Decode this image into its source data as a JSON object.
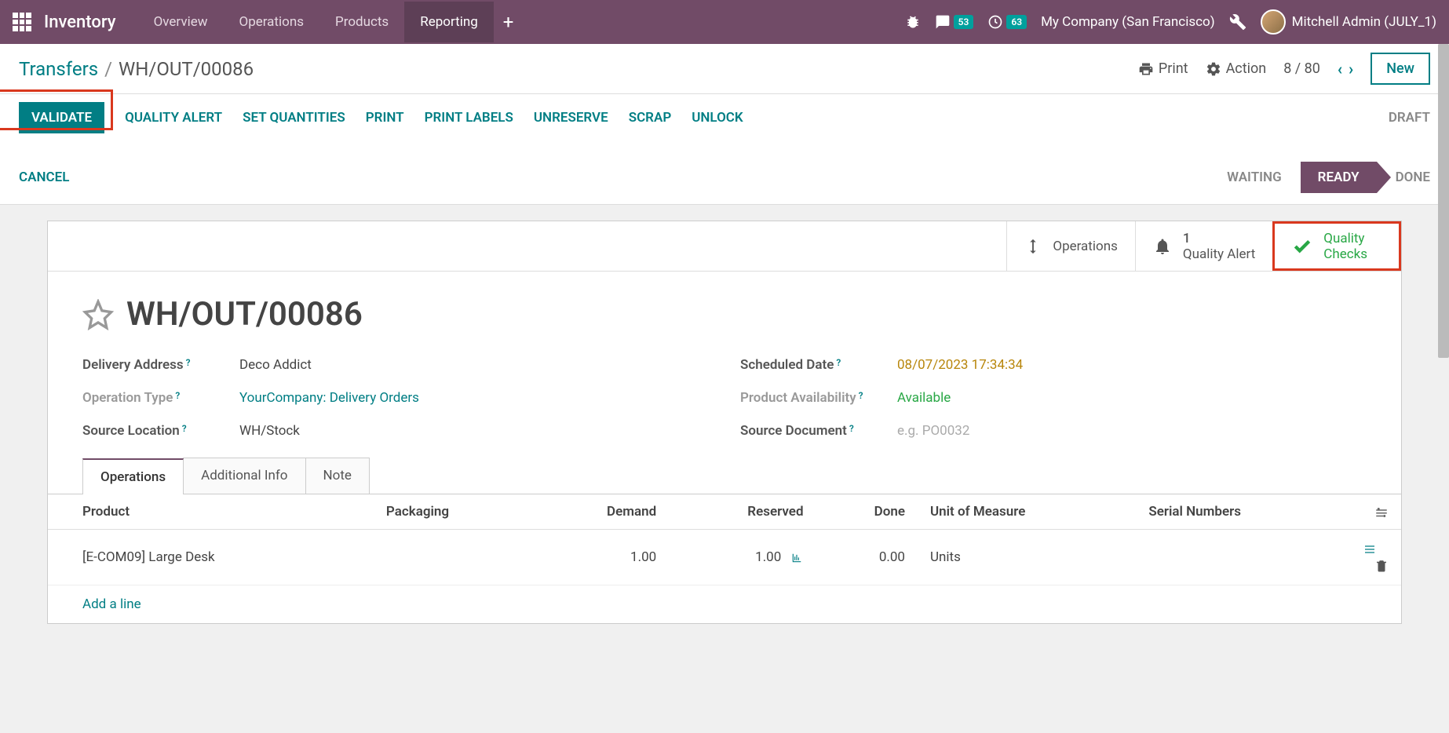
{
  "navbar": {
    "brand": "Inventory",
    "menu": [
      "Overview",
      "Operations",
      "Products",
      "Reporting"
    ],
    "active_index": 3,
    "msg_badge": "53",
    "clock_badge": "63",
    "company": "My Company (San Francisco)",
    "user": "Mitchell Admin (JULY_1)"
  },
  "breadcrumb": {
    "parent": "Transfers",
    "current": "WH/OUT/00086",
    "print": "Print",
    "action": "Action",
    "pager": "8 / 80",
    "new": "New"
  },
  "actions": {
    "validate": "VALIDATE",
    "quality_alert": "QUALITY ALERT",
    "set_qty": "SET QUANTITIES",
    "print": "PRINT",
    "print_labels": "PRINT LABELS",
    "unreserve": "UNRESERVE",
    "scrap": "SCRAP",
    "unlock": "UNLOCK",
    "cancel": "CANCEL"
  },
  "status": {
    "draft": "DRAFT",
    "waiting": "WAITING",
    "ready": "READY",
    "done": "DONE"
  },
  "stat_buttons": {
    "operations": "Operations",
    "quality_alert_count": "1",
    "quality_alert_label": "Quality Alert",
    "quality_checks": "Quality Checks"
  },
  "doc": {
    "title": "WH/OUT/00086",
    "fields": {
      "delivery_address_label": "Delivery Address",
      "delivery_address": "Deco Addict",
      "operation_type_label": "Operation Type",
      "operation_type": "YourCompany: Delivery Orders",
      "source_location_label": "Source Location",
      "source_location": "WH/Stock",
      "scheduled_date_label": "Scheduled Date",
      "scheduled_date": "08/07/2023 17:34:34",
      "product_availability_label": "Product Availability",
      "product_availability": "Available",
      "source_document_label": "Source Document",
      "source_document_placeholder": "e.g. PO0032"
    }
  },
  "tabs": [
    "Operations",
    "Additional Info",
    "Note"
  ],
  "active_tab": 0,
  "table": {
    "headers": {
      "product": "Product",
      "packaging": "Packaging",
      "demand": "Demand",
      "reserved": "Reserved",
      "done": "Done",
      "uom": "Unit of Measure",
      "serial": "Serial Numbers"
    },
    "rows": [
      {
        "product": "[E-COM09] Large Desk",
        "packaging": "",
        "demand": "1.00",
        "reserved": "1.00",
        "done": "0.00",
        "uom": "Units"
      }
    ],
    "add_line": "Add a line"
  }
}
